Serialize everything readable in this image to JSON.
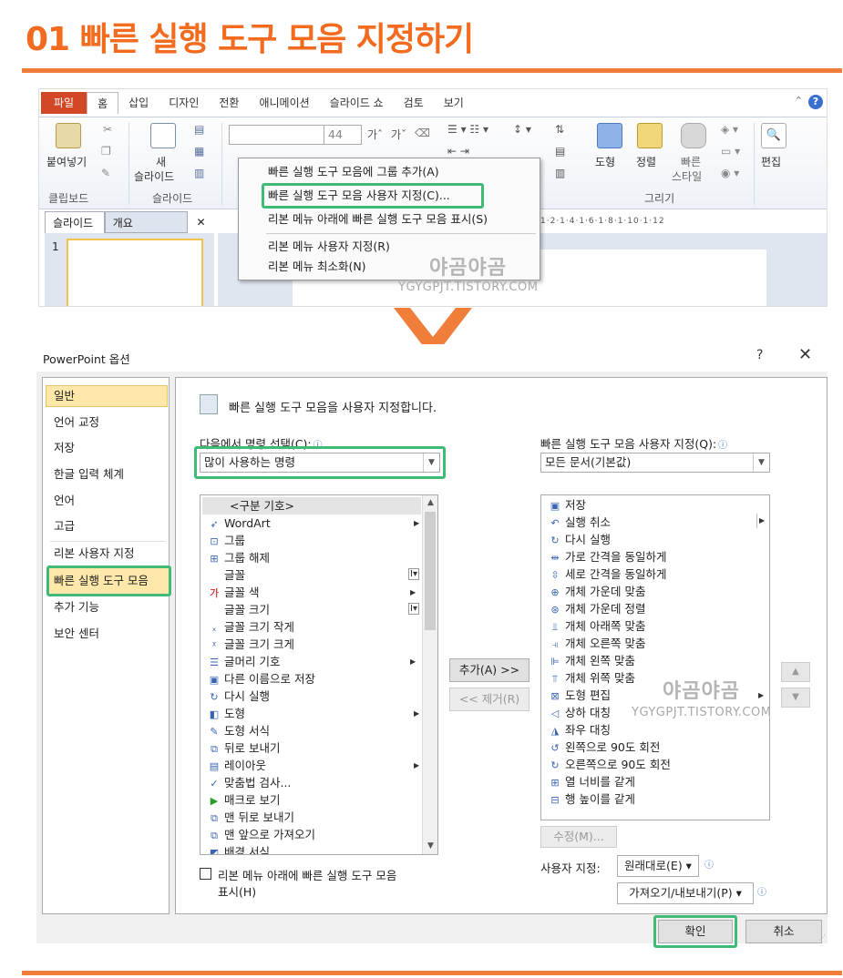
{
  "page": {
    "title": "01 빠른 실행 도구 모음 지정하기"
  },
  "ribbon": {
    "tabs": [
      "파일",
      "홈",
      "삽입",
      "디자인",
      "전환",
      "애니메이션",
      "슬라이드 쇼",
      "검토",
      "보기"
    ],
    "paste_label": "붙여넣기",
    "new_slide_label_1": "새",
    "new_slide_label_2": "슬라이드",
    "font_size": "44",
    "shape_label": "도형",
    "arrange_label": "정렬",
    "quick_style_label_1": "빠른",
    "quick_style_label_2": "스타일",
    "editing_label": "편집",
    "group_clipboard": "클립보드",
    "group_slides": "슬라이드",
    "group_drawing": "그리기",
    "panel_tab_slides": "슬라이드",
    "panel_tab_outline": "개요",
    "panel_close": "✕",
    "slide_number": "1",
    "ruler_text": "1·2·1·4·1·6·1·8·1·10·1·12"
  },
  "context_menu": {
    "items": [
      "빠른 실행 도구 모음에 그룹 추가(A)",
      "빠른 실행 도구 모음 사용자 지정(C)...",
      "리본 메뉴 아래에 빠른 실행 도구 모음 표시(S)",
      "리본 메뉴 사용자 지정(R)",
      "리본 메뉴 최소화(N)"
    ]
  },
  "watermark": {
    "logo": "야곰야곰",
    "url": "YGYGPJT.TISTORY.COM"
  },
  "dialog": {
    "title": "PowerPoint 옵션",
    "help": "?",
    "close": "✕",
    "nav": [
      "일반",
      "언어 교정",
      "저장",
      "한글 입력 체계",
      "언어",
      "고급",
      "리본 사용자 지정",
      "빠른 실행 도구 모음",
      "추가 기능",
      "보안 센터"
    ],
    "heading": "빠른 실행 도구 모음을 사용자 지정합니다.",
    "choose_from_label": "다음에서 명령 선택(C):",
    "choose_from_value": "많이 사용하는 명령",
    "customize_label": "빠른 실행 도구 모음 사용자 지정(Q):",
    "customize_value": "모든 문서(기본값)",
    "commands": [
      "<구분 기호>",
      "WordArt",
      "그룹",
      "그룹 해제",
      "글꼴",
      "글꼴 색",
      "글꼴 크기",
      "글꼴 크기 작게",
      "글꼴 크기 크게",
      "글머리 기호",
      "다른 이름으로 저장",
      "다시 실행",
      "도형",
      "도형 서식",
      "뒤로 보내기",
      "레이아웃",
      "맞춤법 검사...",
      "매크로 보기",
      "맨 뒤로 보내기",
      "맨 앞으로 가져오기",
      "배경 서식"
    ],
    "qat_commands": [
      "저장",
      "실행 취소",
      "다시 실행",
      "가로 간격을 동일하게",
      "세로 간격을 동일하게",
      "개체 가운데 맞춤",
      "개체 가운데 정렬",
      "개체 아래쪽 맞춤",
      "개체 오른쪽 맞춤",
      "개체 왼쪽 맞춤",
      "개체 위쪽 맞춤",
      "도형 편집",
      "상하 대칭",
      "좌우 대칭",
      "왼쪽으로 90도 회전",
      "오른쪽으로 90도 회전",
      "열 너비를 같게",
      "행 높이를 같게"
    ],
    "add_button": "추가(A) >>",
    "remove_button": "<< 제거(R)",
    "modify_button": "수정(M)...",
    "customizations_label": "사용자 지정:",
    "reset_button": "원래대로(E) ▾",
    "import_export_button": "가져오기/내보내기(P) ▾",
    "show_below_line1": "리본 메뉴 아래에 빠른 실행 도구 모음",
    "show_below_line2": "표시(H)",
    "ok_button": "확인",
    "cancel_button": "취소"
  },
  "colors": {
    "accent_orange": "#f26b1f",
    "highlight_green": "#3fba77",
    "selection_yellow": "#fde7a9"
  }
}
